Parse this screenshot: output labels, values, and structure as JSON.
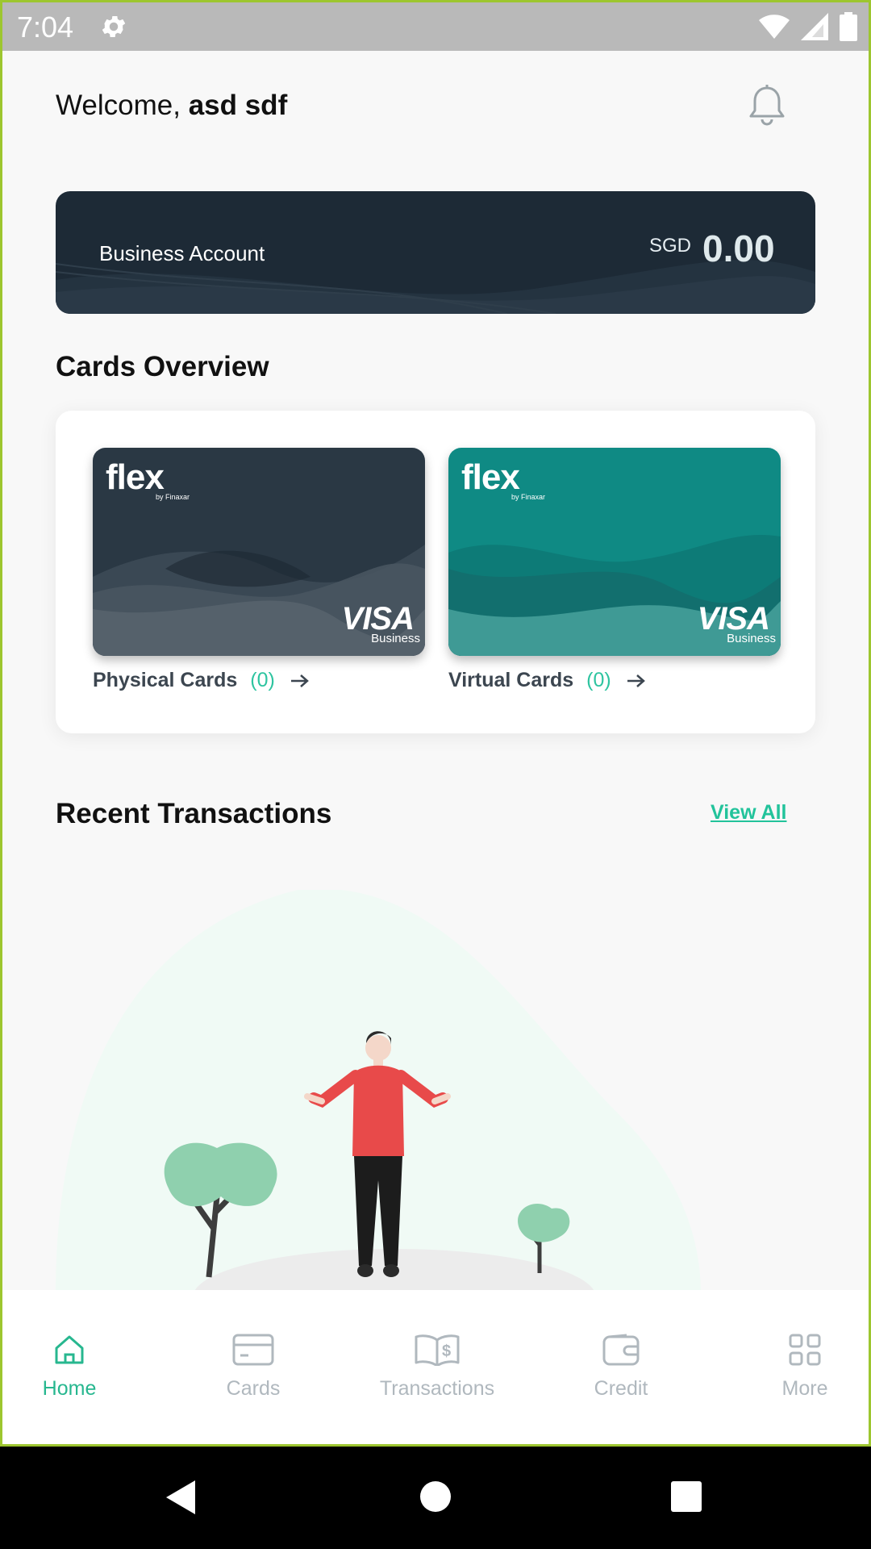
{
  "status_bar": {
    "time": "7:04"
  },
  "header": {
    "welcome_prefix": "Welcome, ",
    "user_name": "asd sdf"
  },
  "account": {
    "label": "Business Account",
    "currency": "SGD",
    "balance": "0.00"
  },
  "cards_overview": {
    "title": "Cards Overview",
    "physical": {
      "brand": "flex",
      "network": "VISA",
      "tier": "Business",
      "label": "Physical Cards",
      "count": "(0)"
    },
    "virtual": {
      "brand": "flex",
      "network": "VISA",
      "tier": "Business",
      "label": "Virtual Cards",
      "count": "(0)"
    }
  },
  "recent_transactions": {
    "title": "Recent Transactions",
    "view_all": "View All"
  },
  "bottom_nav": {
    "items": [
      {
        "label": "Home",
        "icon": "home-icon",
        "active": true
      },
      {
        "label": "Cards",
        "icon": "card-icon",
        "active": false
      },
      {
        "label": "Transactions",
        "icon": "book-dollar-icon",
        "active": false
      },
      {
        "label": "Credit",
        "icon": "wallet-icon",
        "active": false
      },
      {
        "label": "More",
        "icon": "grid-icon",
        "active": false
      }
    ]
  },
  "colors": {
    "accent": "#27b78f",
    "account_bg": "#1d2a36",
    "physical_card": "#2a3844",
    "virtual_card": "#0f8a84"
  }
}
